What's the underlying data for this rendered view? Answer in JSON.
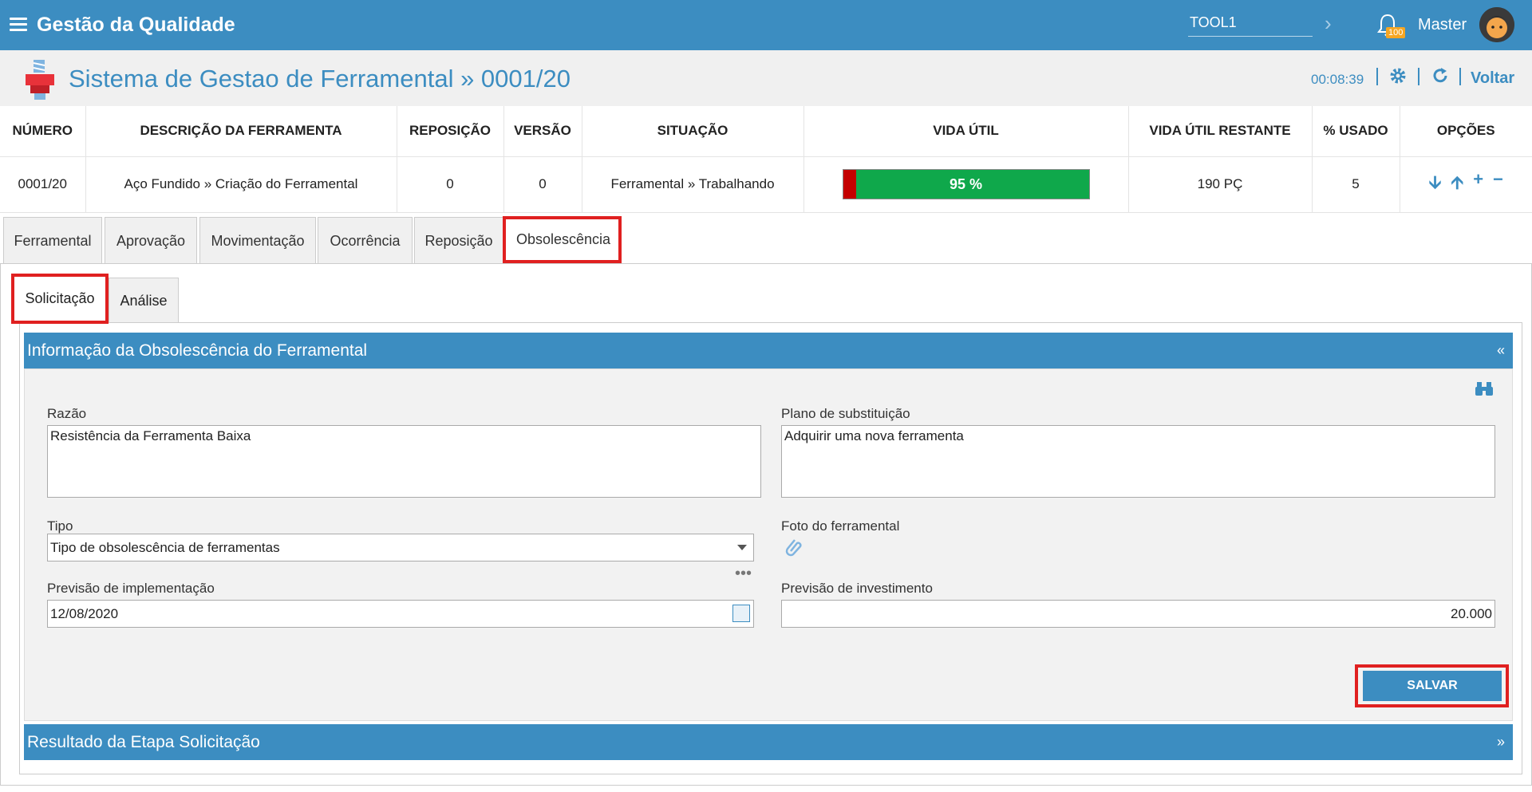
{
  "topbar": {
    "title": "Gestão da Qualidade",
    "tool_value": "TOOL1",
    "notif_count": "100",
    "user_name": "Master"
  },
  "header": {
    "page_title": "Sistema de Gestao de Ferramental » 0001/20",
    "timer": "00:08:39",
    "back_label": "Voltar"
  },
  "table": {
    "headers": [
      "NÚMERO",
      "DESCRIÇÃO DA FERRAMENTA",
      "REPOSIÇÃO",
      "VERSÃO",
      "SITUAÇÃO",
      "VIDA ÚTIL",
      "VIDA ÚTIL RESTANTE",
      "% USADO",
      "OPÇÕES"
    ],
    "row": {
      "numero": "0001/20",
      "descricao": "Aço Fundido » Criação do Ferramental",
      "reposicao": "0",
      "versao": "0",
      "situacao": "Ferramental » Trabalhando",
      "vida_util_label": "95 %",
      "vida_util_remaining_fraction": 0.95,
      "vida_restante": "190 PÇ",
      "usado": "5"
    }
  },
  "tabs": [
    "Ferramental",
    "Aprovação",
    "Movimentação",
    "Ocorrência",
    "Reposição",
    "Obsolescência"
  ],
  "subtabs": [
    "Solicitação",
    "Análise"
  ],
  "section1_title": "Informação da Obsolescência do Ferramental",
  "section2_title": "Resultado da Etapa Solicitação",
  "form": {
    "razao_label": "Razão",
    "razao_value": "Resistência da Ferramenta Baixa",
    "plano_label": "Plano de substituição",
    "plano_value": "Adquirir uma nova ferramenta",
    "tipo_label": "Tipo",
    "tipo_value": "Tipo de obsolescência de ferramentas",
    "foto_label": "Foto do ferramental",
    "previsao_impl_label": "Previsão de implementação",
    "previsao_impl_value": "12/08/2020",
    "previsao_inv_label": "Previsão de investimento",
    "previsao_inv_value": "20.000",
    "save_label": "SALVAR"
  },
  "colors": {
    "accent": "#3c8dc1",
    "progress_green": "#0fa84b",
    "progress_red": "#c40000",
    "highlight": "#e02020"
  }
}
